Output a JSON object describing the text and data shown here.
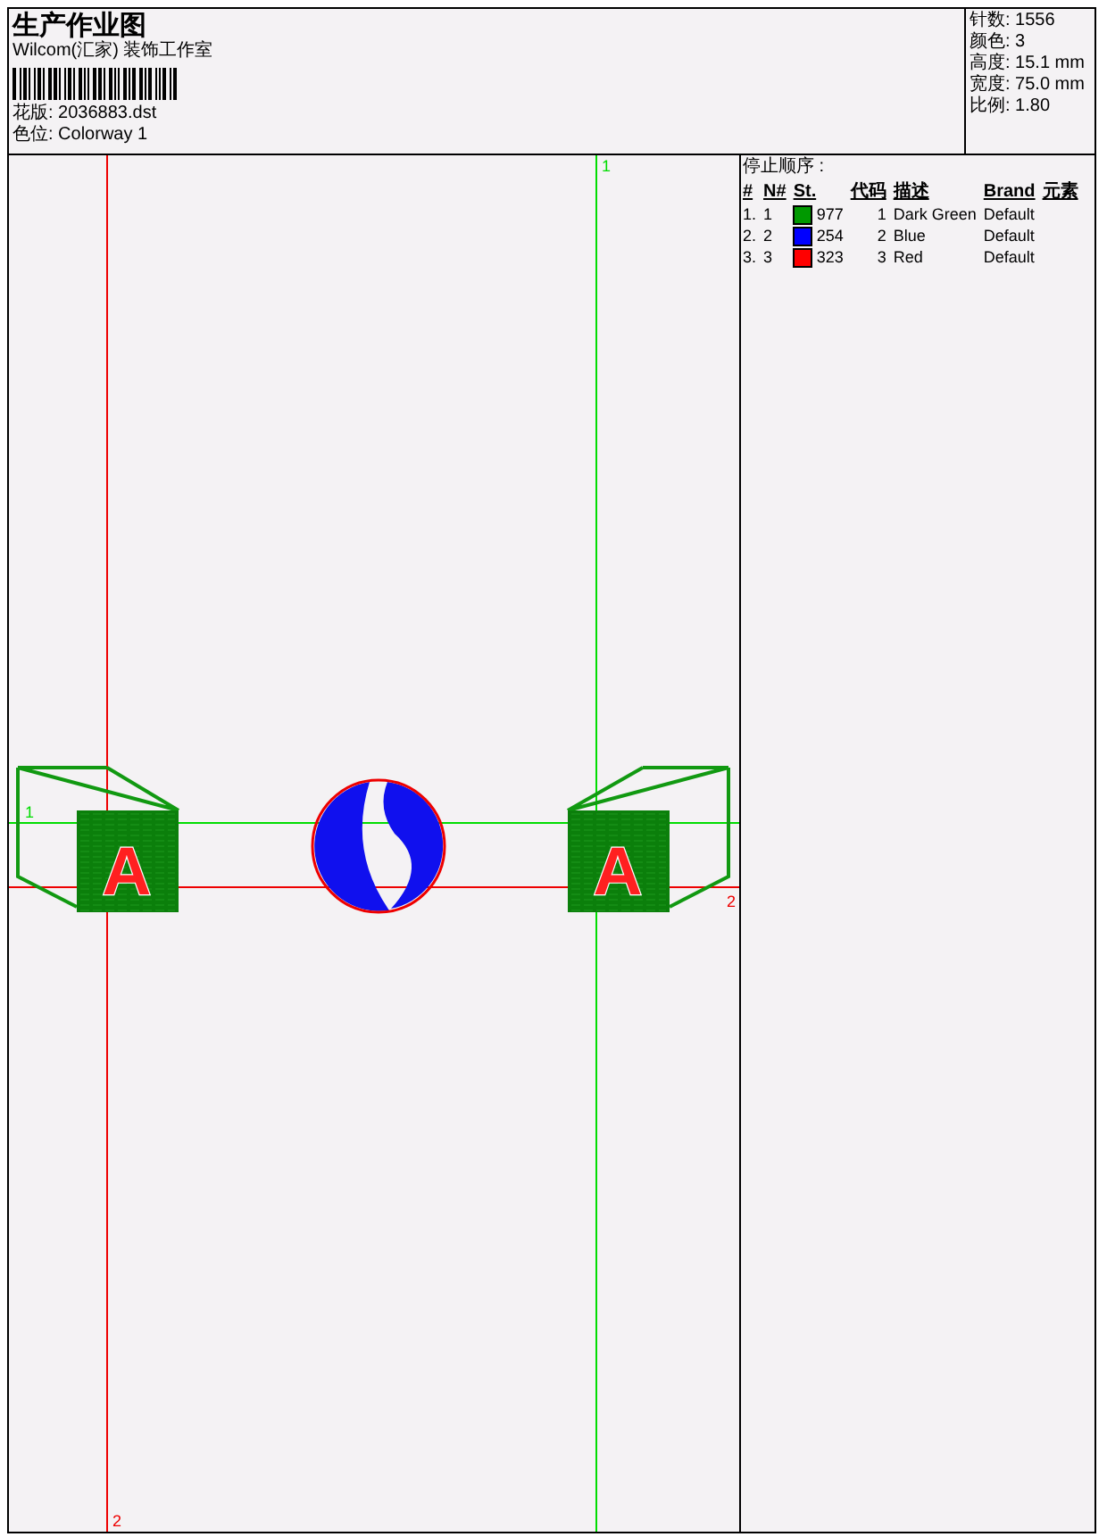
{
  "title": "生产作业图",
  "company": "Wilcom(汇家) 装饰工作室",
  "design_file": "花版: 2036883.dst",
  "colorway": "色位: Colorway 1",
  "stats": [
    "针数: 1556",
    "颜色: 3",
    "高度: 15.1 mm",
    "宽度: 75.0 mm",
    "比例: 1.80"
  ],
  "stop_sequence": {
    "title": "停止顺序 :",
    "columns": [
      "#",
      "N#",
      "St.",
      "代码",
      "描述",
      "Brand",
      "元素"
    ],
    "rows": [
      {
        "index": "1.",
        "number": "1",
        "color": "#009900",
        "stitches": "977",
        "code": "1",
        "description": "Dark Green",
        "brand": "Default"
      },
      {
        "index": "2.",
        "number": "2",
        "color": "#0000ff",
        "stitches": "254",
        "code": "2",
        "description": "Blue",
        "brand": "Default"
      },
      {
        "index": "3.",
        "number": "3",
        "color": "#ff0000",
        "stitches": "323",
        "code": "3",
        "description": "Red",
        "brand": "Default"
      }
    ]
  },
  "guides": [
    {
      "label": "1",
      "color": "#00dd00"
    },
    {
      "label": "2",
      "color": "#ee0000"
    },
    {
      "label": "1",
      "color": "#00dd00"
    },
    {
      "label": "2",
      "color": "#ee0000"
    }
  ],
  "motifs": [
    {
      "kind": "cube",
      "letter": "A"
    },
    {
      "kind": "ball"
    },
    {
      "kind": "cube",
      "letter": "A"
    }
  ]
}
